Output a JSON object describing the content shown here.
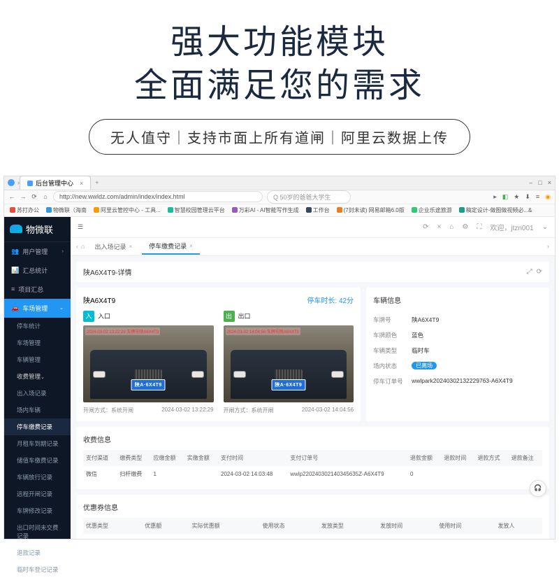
{
  "hero": {
    "line1": "强大功能模块",
    "line2": "全面满足您的需求",
    "pill": "无人值守｜支持市面上所有道闸｜阿里云数据上传"
  },
  "browser": {
    "tab_title": "后台管理中心",
    "url": "http://new.wwldz.com/admin/index/index.html",
    "search_placeholder": "50岁的爸爸大学生",
    "bookmarks": [
      "苏打办公",
      "物微联（海南",
      "阿里云管控中心 - 工具...",
      "智慧校园管理云平台",
      "万彩AI - AI智能写作生成",
      "工作台",
      "(7封未读) 网易邮箱6.0版",
      "企业乐途旅游",
      "稿定设计-做图做视频必...&"
    ]
  },
  "sidebar": {
    "brand": "物微联",
    "items": [
      {
        "label": "用户管理",
        "icon": "users"
      },
      {
        "label": "汇总统计",
        "icon": "chart"
      },
      {
        "label": "项目汇总",
        "icon": "list"
      },
      {
        "label": "车场管理",
        "icon": "car",
        "active": true
      }
    ],
    "subs1": [
      "停车统计",
      "车场管理",
      "车辆管理"
    ],
    "fee_group": "收费管理",
    "subs2": [
      "出入场记录",
      "场内车辆",
      "停车缴费记录",
      "月租车到期记录",
      "储值车缴费记录",
      "车辆放行记录",
      "远程开闸记录",
      "车牌修改记录",
      "出口时间未交费记录",
      "退款记录",
      "临时车登记记录"
    ],
    "active_sub": "停车缴费记录"
  },
  "topbar": {
    "welcome": "欢迎，jtzn001"
  },
  "tabs": {
    "t1": "出入场记录",
    "t2": "停车缴费记录"
  },
  "detail": {
    "title": "陕A6X4T9-详情",
    "plate": "陕A6X4T9",
    "park_duration": "停车时长: 42分",
    "entry": {
      "badge": "入",
      "label": "入口",
      "redtext": "2024-03-02 13:22:29 车牌号陕A6X4T9",
      "plate_display": "陕A·6X4T9",
      "open_mode": "开闸方式：系统开闸",
      "time": "2024-03-02 13:22:29"
    },
    "exit": {
      "badge": "出",
      "label": "出口",
      "redtext": "2024-03-02 14:04:56 车牌号陕A6X4T9",
      "plate_display": "陕A·6X4T9",
      "open_mode": "开闸方式：系统开闸",
      "time": "2024-03-02 14:04:56"
    }
  },
  "vehicle_info": {
    "title": "车辆信息",
    "rows": {
      "plate_label": "车牌号",
      "plate_value": "陕A6X4T9",
      "color_label": "车牌颜色",
      "color_value": "蓝色",
      "type_label": "车辆类型",
      "type_value": "临时车",
      "status_label": "场内状态",
      "status_value": "已离场",
      "order_label": "停车订单号",
      "order_value": "wwlpark20240302132229763-A6X4T9"
    }
  },
  "fee": {
    "title": "收费信息",
    "headers": [
      "支付渠道",
      "缴费类型",
      "应缴金额",
      "实缴金额",
      "支付时间",
      "支付订单号",
      "退款金额",
      "退款时间",
      "退款方式",
      "退款备注"
    ],
    "row": [
      "微信",
      "扫杆缴费",
      "1",
      "",
      "2024-03-02 14:03:48",
      "wwlp220240302140345635Z-A6X4T9",
      "0",
      "",
      "",
      ""
    ]
  },
  "coupon": {
    "title": "优惠券信息",
    "headers": [
      "优惠类型",
      "优惠额",
      "实际优惠额",
      "使用状态",
      "发放类型",
      "发放时间",
      "使用时间",
      "发放人"
    ]
  }
}
